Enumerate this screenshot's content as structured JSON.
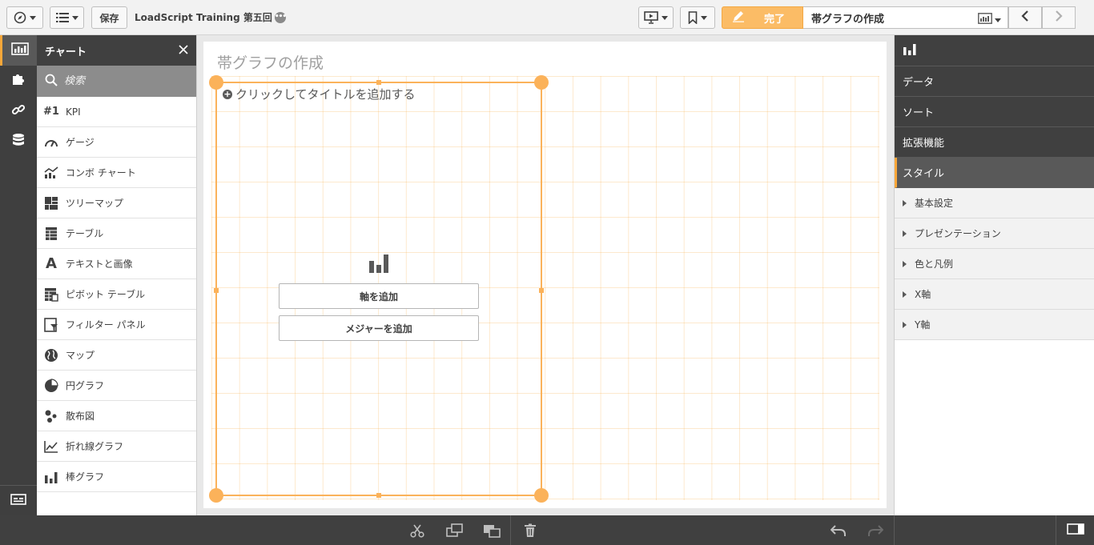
{
  "toolbar": {
    "save_label": "保存",
    "app_title": "LoadScript Training 第五回",
    "more_label": "•••",
    "done_label": "完了",
    "sheet_title": "帯グラフの作成"
  },
  "asset_panel": {
    "title": "チャート",
    "search_placeholder": "検索",
    "items": [
      {
        "label": "KPI",
        "icon_text": "#1"
      },
      {
        "label": "ゲージ"
      },
      {
        "label": "コンボ チャート"
      },
      {
        "label": "ツリーマップ"
      },
      {
        "label": "テーブル"
      },
      {
        "label": "テキストと画像",
        "icon_text": "A"
      },
      {
        "label": "ピボット テーブル"
      },
      {
        "label": "フィルター パネル"
      },
      {
        "label": "マップ"
      },
      {
        "label": "円グラフ"
      },
      {
        "label": "散布図"
      },
      {
        "label": "折れ線グラフ"
      },
      {
        "label": "棒グラフ"
      }
    ]
  },
  "canvas": {
    "sheet_title": "帯グラフの作成",
    "object": {
      "title_placeholder": "クリックしてタイトルを追加する",
      "add_dimension": "軸を追加",
      "add_measure": "メジャーを追加"
    }
  },
  "properties": {
    "tabs": [
      "データ",
      "ソート",
      "拡張機能",
      "スタイル"
    ],
    "active_tab": "スタイル",
    "sections": [
      "基本設定",
      "プレゼンテーション",
      "色と凡例",
      "X軸",
      "Y軸"
    ]
  },
  "colors": {
    "accent": "#f8a739",
    "dark_panel": "#404040",
    "selection": "#fbb25a"
  }
}
